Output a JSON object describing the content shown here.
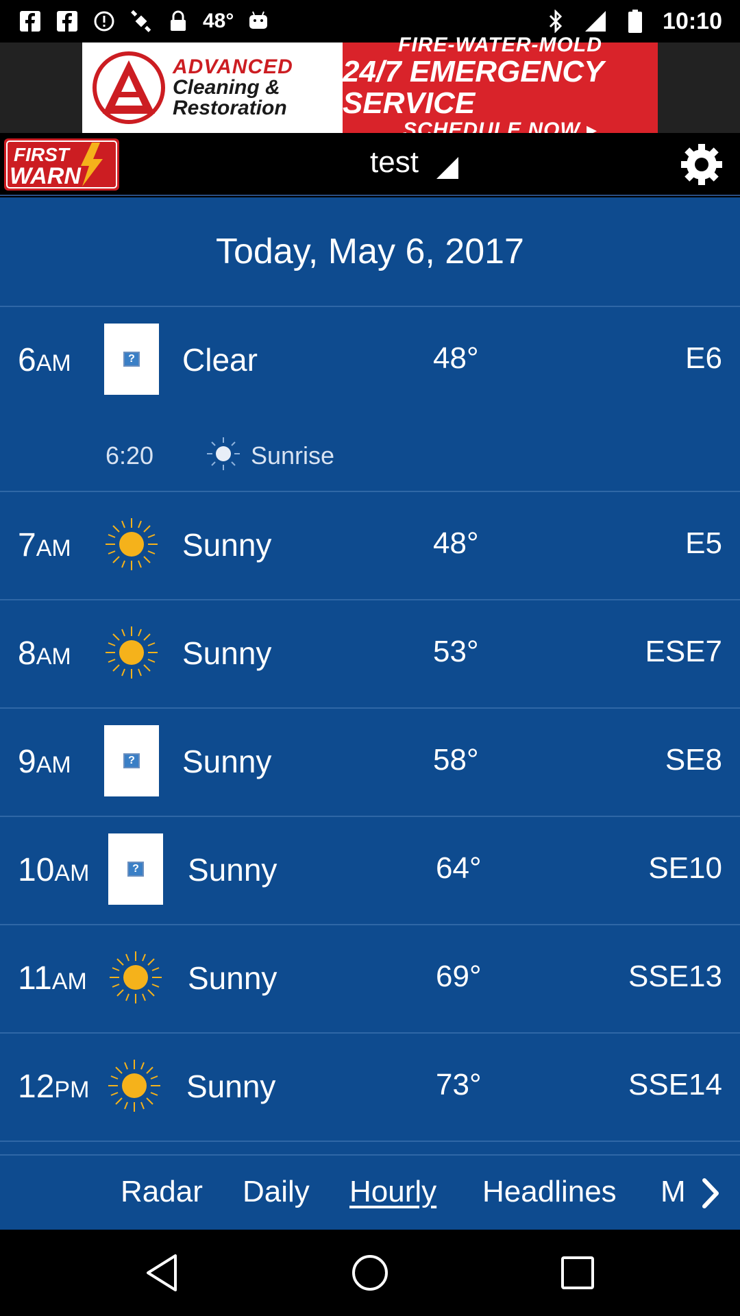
{
  "status_bar": {
    "temperature": "48°",
    "time": "10:10",
    "icons": [
      "facebook-icon",
      "facebook-icon",
      "alert-icon",
      "gps-icon",
      "lock-icon",
      "android-icon",
      "bluetooth-icon",
      "signal-icon",
      "battery-icon"
    ]
  },
  "ad": {
    "brand_line1": "ADVANCED",
    "brand_line2": "Cleaning &",
    "brand_line3": "Restoration",
    "line1": "FIRE-WATER-MOLD",
    "line2": "24/7 EMERGENCY SERVICE",
    "line3": "SCHEDULE NOW ▸",
    "color": "#d9232a"
  },
  "header": {
    "logo_line1": "FIRST",
    "logo_line2": "WARN",
    "location": "test"
  },
  "forecast": {
    "date": "Today, May 6, 2017",
    "sunrise": {
      "time": "6:20",
      "label": "Sunrise"
    },
    "hours": [
      {
        "hour": "6",
        "period": "AM",
        "condition": "Clear",
        "temp": "48°",
        "wind": "E6",
        "icon": "placeholder-icon"
      },
      {
        "hour": "7",
        "period": "AM",
        "condition": "Sunny",
        "temp": "48°",
        "wind": "E5",
        "icon": "sun-icon"
      },
      {
        "hour": "8",
        "period": "AM",
        "condition": "Sunny",
        "temp": "53°",
        "wind": "ESE7",
        "icon": "sun-icon"
      },
      {
        "hour": "9",
        "period": "AM",
        "condition": "Sunny",
        "temp": "58°",
        "wind": "SE8",
        "icon": "placeholder-icon"
      },
      {
        "hour": "10",
        "period": "AM",
        "condition": "Sunny",
        "temp": "64°",
        "wind": "SE10",
        "icon": "placeholder-icon"
      },
      {
        "hour": "11",
        "period": "AM",
        "condition": "Sunny",
        "temp": "69°",
        "wind": "SSE13",
        "icon": "sun-icon"
      },
      {
        "hour": "12",
        "period": "PM",
        "condition": "Sunny",
        "temp": "73°",
        "wind": "SSE14",
        "icon": "sun-icon"
      }
    ]
  },
  "tabs": {
    "items": [
      "Radar",
      "Daily",
      "Hourly",
      "Headlines",
      "M"
    ],
    "active": "Hourly"
  },
  "colors": {
    "content_bg": "#0e4b8f",
    "sun": "#f5b21b",
    "divider": "#2f67a6"
  }
}
